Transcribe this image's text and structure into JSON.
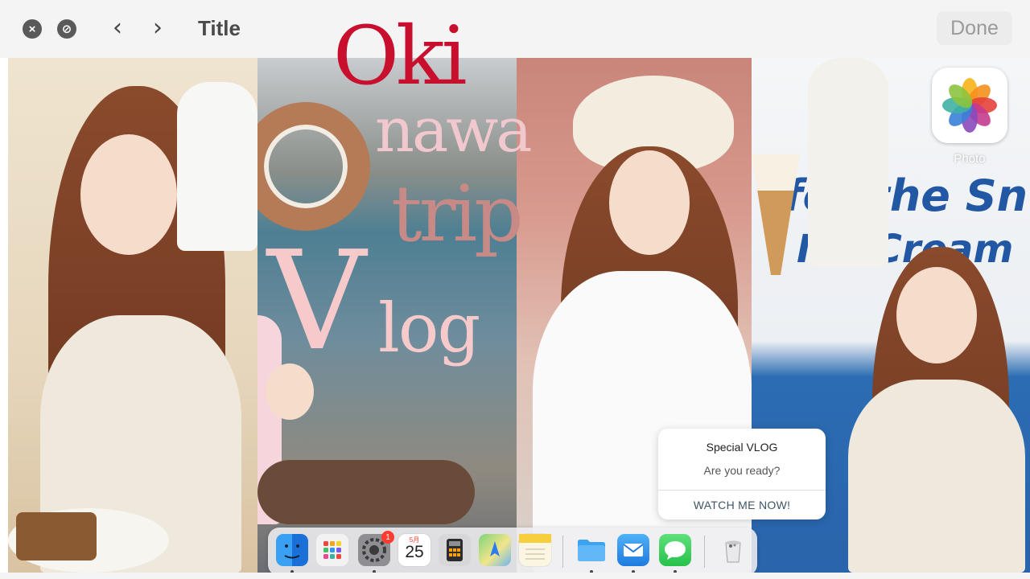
{
  "window": {
    "title": "Title",
    "done_label": "Done",
    "close_glyph": "×",
    "block_glyph": "⊘",
    "back_glyph": "‹",
    "forward_glyph": "›"
  },
  "headline": {
    "line1": "Oki",
    "line2": "nawa",
    "line3": "trip",
    "line4a": "V",
    "line4b": "log"
  },
  "panel_text": {
    "banner_line1": "for the Sn",
    "banner_line2": "Ice Cream"
  },
  "desktop_icon": {
    "label": "Photo",
    "icon": "photos-icon"
  },
  "notification": {
    "title": "Special VLOG",
    "message": "Are you ready?",
    "action": "WATCH ME NOW!"
  },
  "dock": {
    "settings_badge": "1",
    "calendar_month": "5月",
    "calendar_day": "25",
    "apps": [
      "finder-icon",
      "launchpad-icon",
      "system-settings-icon",
      "calendar-icon",
      "calculator-icon",
      "maps-icon",
      "notes-icon",
      "folder-icon",
      "mail-icon",
      "messages-icon",
      "trash-icon"
    ]
  },
  "colors": {
    "headline_red": "#c8102e",
    "headline_pink": "#f2c8cf",
    "headline_rose": "#c78a86",
    "banner_blue": "#2257a3"
  }
}
